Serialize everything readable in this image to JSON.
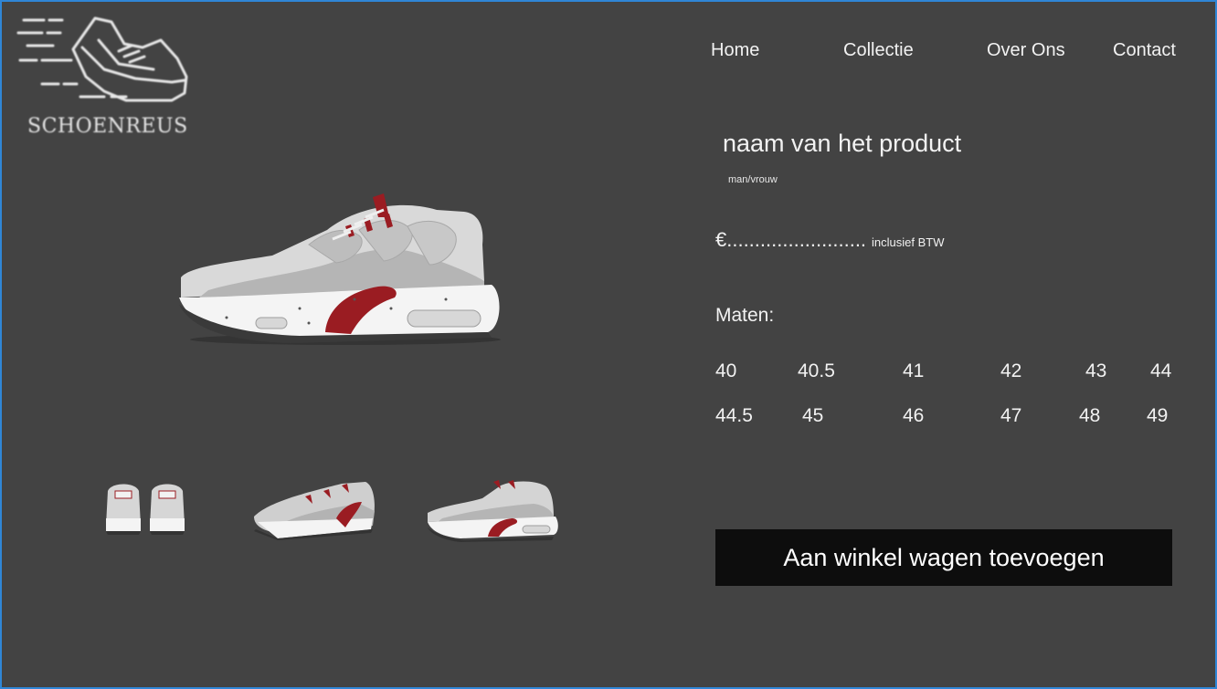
{
  "brand": {
    "name": "SCHOENREUS",
    "logo_icon": "running-shoe-logo-icon"
  },
  "nav": {
    "items": [
      {
        "label": "Home"
      },
      {
        "label": "Collectie"
      },
      {
        "label": "Over Ons"
      },
      {
        "label": "Contact"
      }
    ]
  },
  "product": {
    "name": "naam van het product",
    "gender": "man/vrouw",
    "price": "€.........................",
    "vat_note": "inclusief BTW",
    "sizes_label": "Maten:",
    "sizes_row1": [
      "40",
      "40.5",
      "41",
      "42",
      "43",
      "44"
    ],
    "sizes_row2": [
      "44.5",
      "45",
      "46",
      "47",
      "48",
      "49"
    ],
    "add_to_cart": "Aan winkel wagen toevoegen",
    "colors": {
      "upper": "#cfcfcf",
      "accent": "#9a1c22",
      "sole": "#f4f4f4",
      "background": "#434343",
      "button": "#0d0d0d"
    }
  }
}
